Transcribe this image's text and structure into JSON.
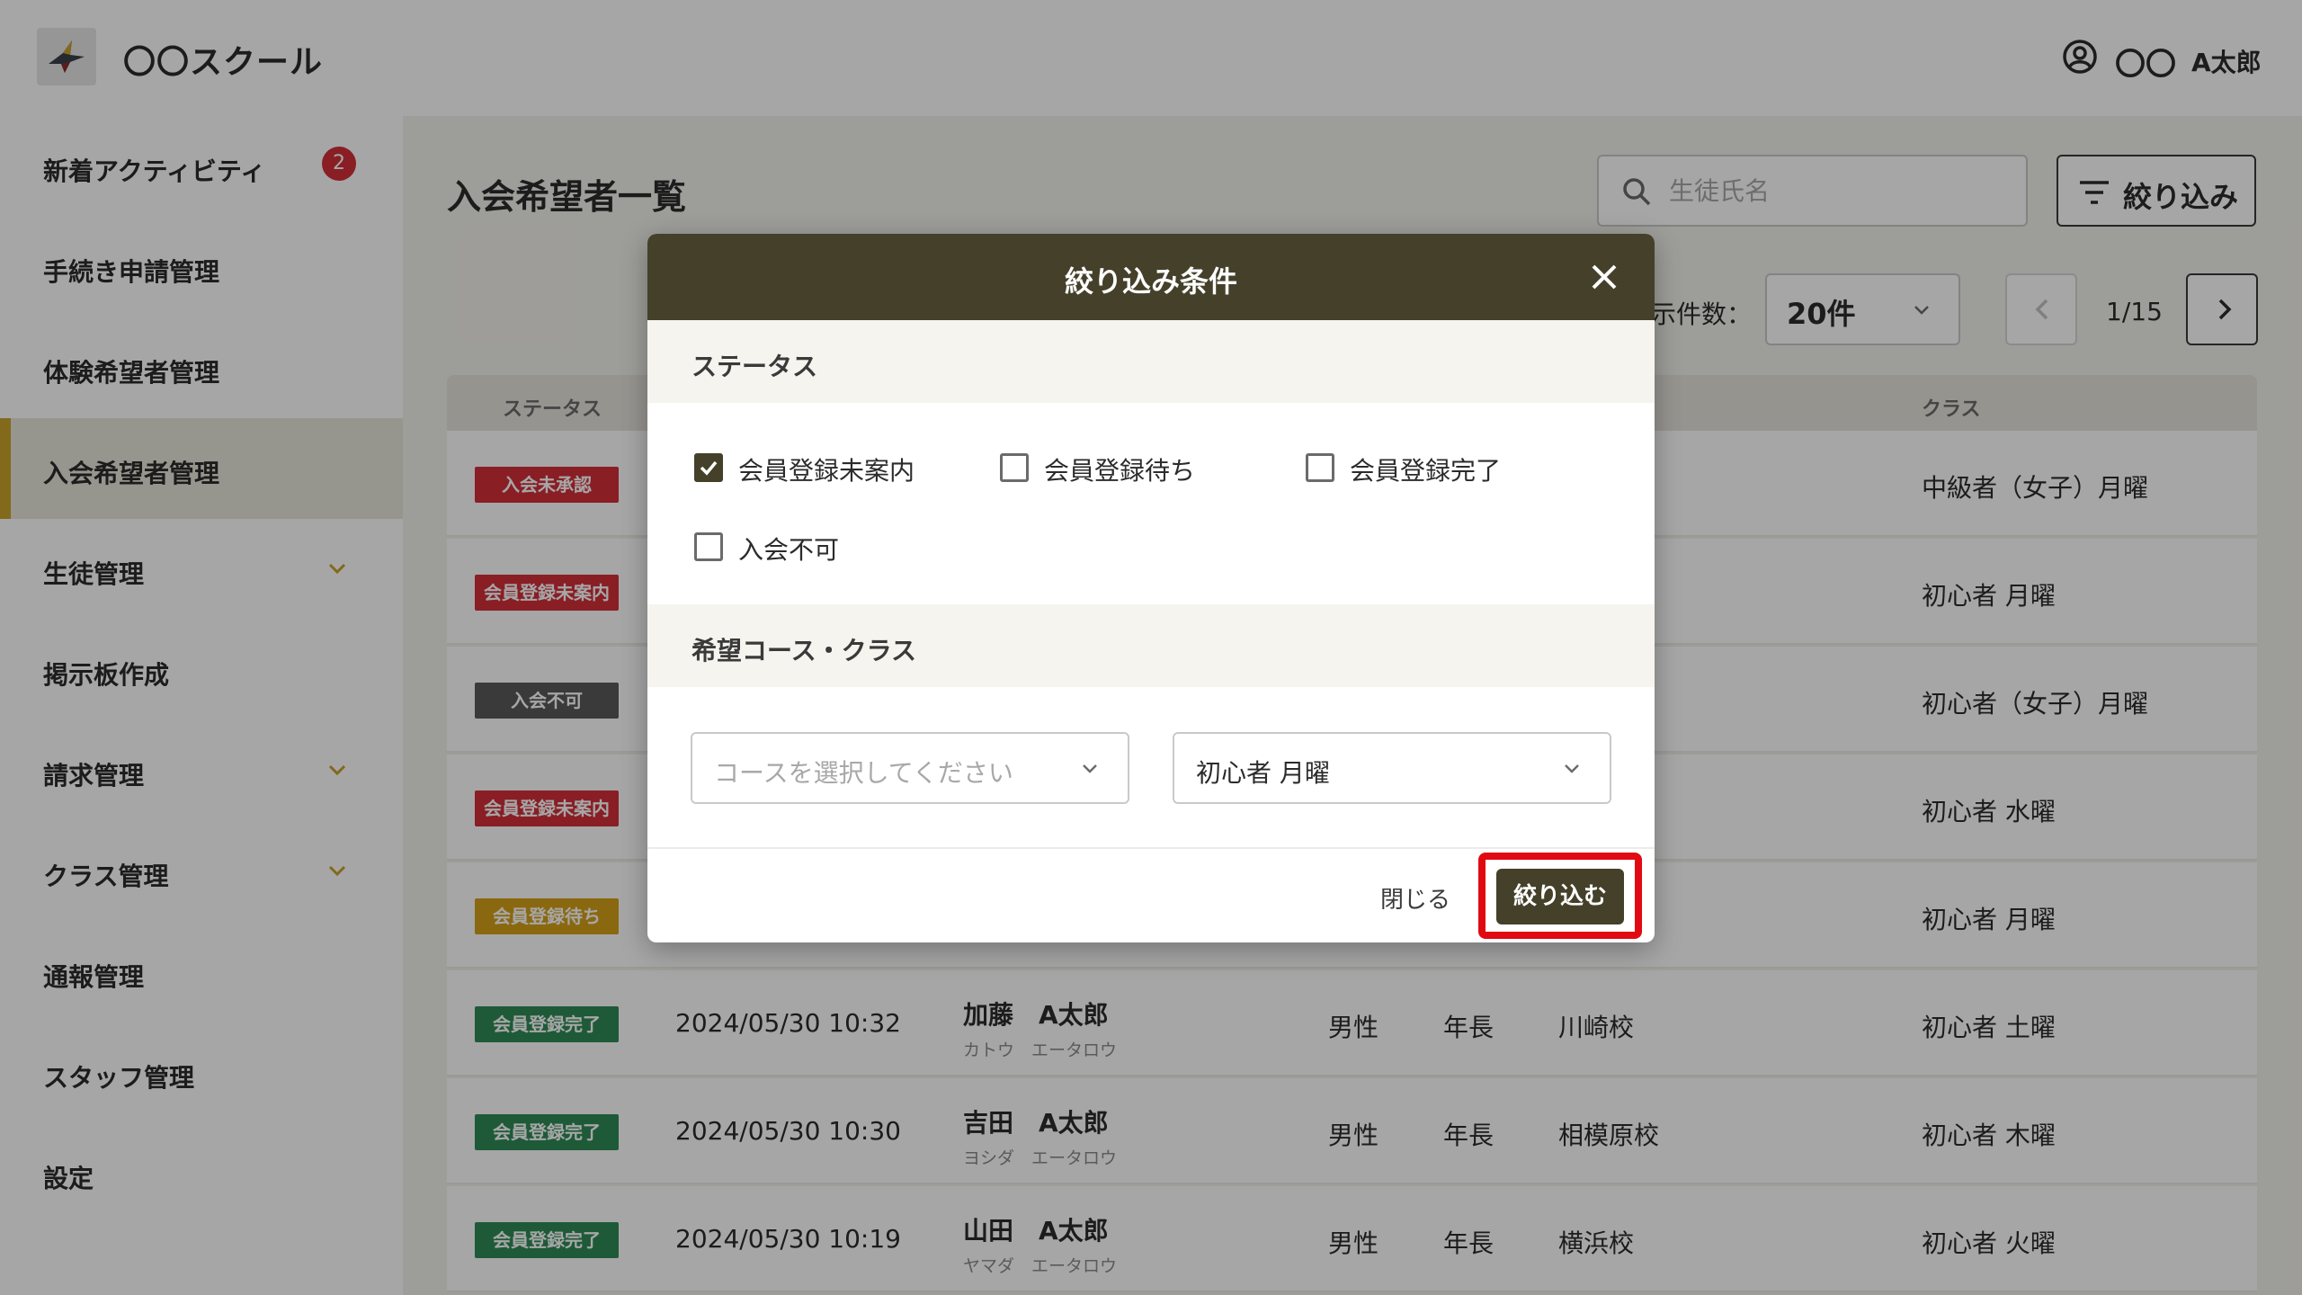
{
  "header": {
    "app_title": "〇〇スクール",
    "user_short": "〇〇",
    "user_name": "A太郎"
  },
  "sidebar": {
    "items": [
      {
        "label": "新着アクティビティ",
        "badge": "2"
      },
      {
        "label": "手続き申請管理"
      },
      {
        "label": "体験希望者管理"
      },
      {
        "label": "入会希望者管理",
        "active": true
      },
      {
        "label": "生徒管理",
        "expandable": true
      },
      {
        "label": "掲示板作成"
      },
      {
        "label": "請求管理",
        "expandable": true
      },
      {
        "label": "クラス管理",
        "expandable": true
      },
      {
        "label": "通報管理"
      },
      {
        "label": "スタッフ管理"
      },
      {
        "label": "設定"
      }
    ]
  },
  "main": {
    "page_title": "入会希望者一覧",
    "search_placeholder": "生徒氏名",
    "filter_button": "絞り込み",
    "per_page_label": "示件数：",
    "per_page_value": "20件",
    "page_info": "1/15"
  },
  "table": {
    "headers": {
      "status": "ステータス",
      "class": "クラス"
    },
    "rows": [
      {
        "status": "入会未承認",
        "status_color": "#d32f3a",
        "date": "",
        "name": "",
        "kana": "",
        "gender": "",
        "grade": "",
        "school": "",
        "class": "中級者（女子）月曜"
      },
      {
        "status": "会員登録未案内",
        "status_color": "#d32f3a",
        "date": "",
        "name": "",
        "kana": "",
        "gender": "",
        "grade": "",
        "school": "",
        "class": "初心者 月曜"
      },
      {
        "status": "入会不可",
        "status_color": "#5a5a5a",
        "date": "",
        "name": "",
        "kana": "",
        "gender": "",
        "grade": "",
        "school": "",
        "class": "初心者（女子）月曜"
      },
      {
        "status": "会員登録未案内",
        "status_color": "#d32f3a",
        "date": "",
        "name": "",
        "kana": "",
        "gender": "",
        "grade": "",
        "school": "",
        "class": "初心者 水曜"
      },
      {
        "status": "会員登録待ち",
        "status_color": "#d4a017",
        "date": "",
        "name": "",
        "kana": "",
        "gender": "",
        "grade": "",
        "school": "",
        "class": "初心者 月曜"
      },
      {
        "status": "会員登録完了",
        "status_color": "#2e8b57",
        "date": "2024/05/30 10:32",
        "name": "加藤　A太郎",
        "kana": "カトウ　エータロウ",
        "gender": "男性",
        "grade": "年長",
        "school": "川崎校",
        "class": "初心者 土曜"
      },
      {
        "status": "会員登録完了",
        "status_color": "#2e8b57",
        "date": "2024/05/30 10:30",
        "name": "吉田　A太郎",
        "kana": "ヨシダ　エータロウ",
        "gender": "男性",
        "grade": "年長",
        "school": "相模原校",
        "class": "初心者 木曜"
      },
      {
        "status": "会員登録完了",
        "status_color": "#2e8b57",
        "date": "2024/05/30 10:19",
        "name": "山田　A太郎",
        "kana": "ヤマダ　エータロウ",
        "gender": "男性",
        "grade": "年長",
        "school": "横浜校",
        "class": "初心者 火曜"
      }
    ]
  },
  "modal": {
    "title": "絞り込み条件",
    "status_section": "ステータス",
    "status_options": [
      {
        "label": "会員登録未案内",
        "checked": true
      },
      {
        "label": "会員登録待ち",
        "checked": false
      },
      {
        "label": "会員登録完了",
        "checked": false
      },
      {
        "label": "入会不可",
        "checked": false
      }
    ],
    "course_section": "希望コース・クラス",
    "course_placeholder": "コースを選択してください",
    "class_value": "初心者 月曜",
    "close_label": "閉じる",
    "apply_label": "絞り込む"
  },
  "colors": {
    "accent": "#c8a22c",
    "modal_header": "#44402a",
    "highlight": "#e20a12"
  }
}
